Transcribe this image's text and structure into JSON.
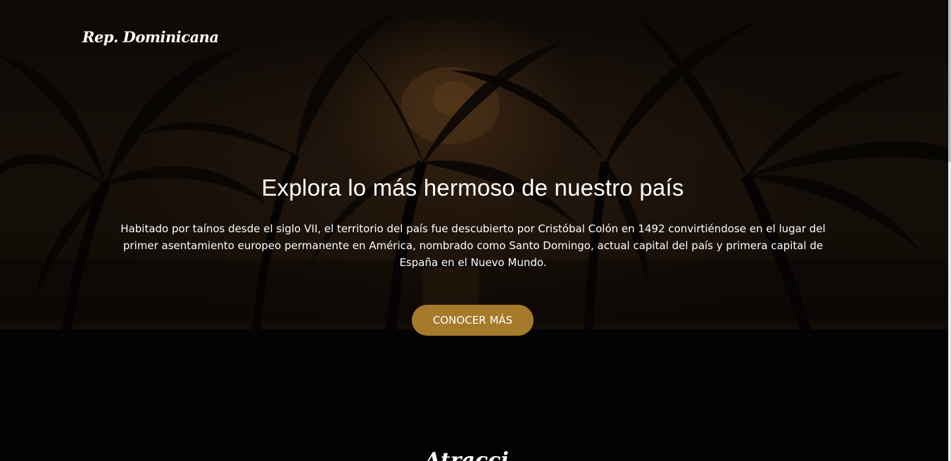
{
  "header": {
    "brand": "Rep. Dominicana"
  },
  "hero": {
    "title": "Explora lo más hermoso de nuestro país",
    "description": "Habitado por taínos desde el siglo VII, el territorio del país fue descubierto por Cristóbal Colón en 1492 convirtiéndose en el lugar del primer asentamiento europeo permanente en América, nombrado como Santo Domingo, actual capital del país y primera capital de España en el Nuevo Mundo.",
    "cta_label": "CONOCER MÁS",
    "background": "palm-trees-sunset-image"
  },
  "next_section": {
    "title_partial": "Atracci"
  },
  "colors": {
    "accent": "#a57a2a",
    "text": "#ffffff",
    "background": "#060404"
  }
}
